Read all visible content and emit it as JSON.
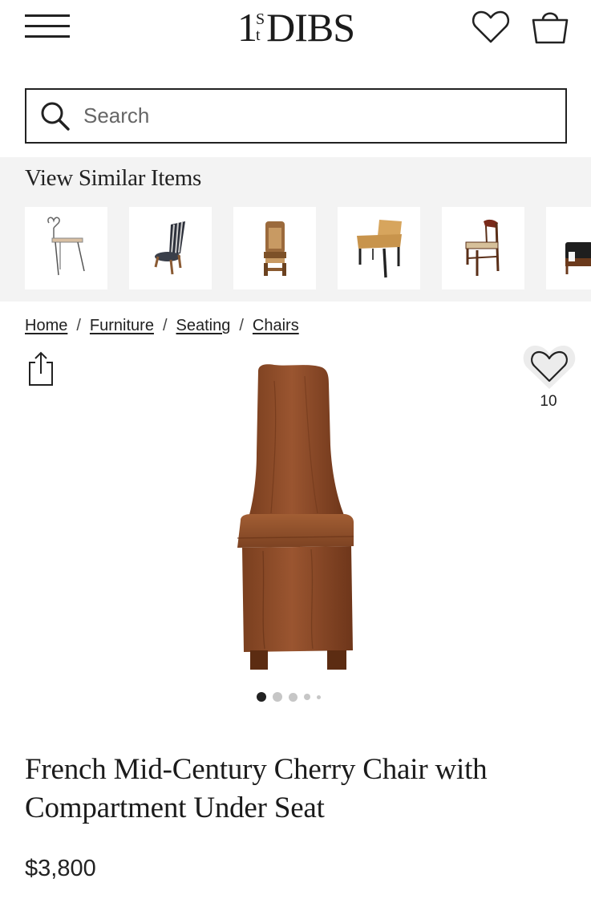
{
  "header": {
    "logo_one": "1",
    "logo_s": "S",
    "logo_t": "t",
    "logo_dibs": "DIBS"
  },
  "search": {
    "placeholder": "Search",
    "value": ""
  },
  "similar": {
    "title": "View Similar Items",
    "items": [
      {
        "icon": "wire-chair-thumbnail"
      },
      {
        "icon": "striped-upholstered-chair-thumbnail"
      },
      {
        "icon": "carved-wood-chair-thumbnail"
      },
      {
        "icon": "mustard-stool-thumbnail"
      },
      {
        "icon": "dark-wood-chair-thumbnail"
      },
      {
        "icon": "black-leather-chair-thumbnail"
      }
    ]
  },
  "breadcrumb": {
    "items": [
      "Home",
      "Furniture",
      "Seating",
      "Chairs"
    ],
    "separator": "/"
  },
  "product": {
    "favorites_count": "10",
    "title": "French Mid-Century Cherry Chair with Compartment Under Seat",
    "price": "$3,800",
    "image_index": 1,
    "image_count": 5
  },
  "colors": {
    "text": "#222222",
    "band": "#f3f3f3",
    "wood": "#8a4a25",
    "dot_active": "#222222",
    "dot_inactive": "#c6c6c6"
  }
}
